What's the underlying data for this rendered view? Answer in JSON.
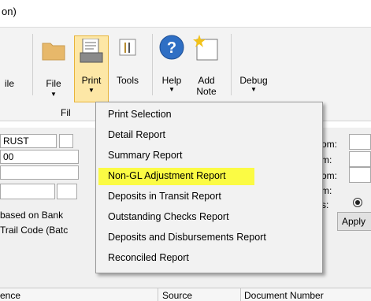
{
  "window": {
    "title_fragment": "on)"
  },
  "ribbon": {
    "file_partial_label": "ile",
    "file_label": "File",
    "print_label": "Print",
    "tools_label": "Tools",
    "help_label": "Help",
    "add_note_label_1": "Add",
    "add_note_label_2": "Note",
    "debug_label": "Debug",
    "group_label_partial": "Fil",
    "dropdown_arrow": "▼"
  },
  "print_menu": {
    "items": [
      "Print Selection",
      "Detail Report",
      "Summary Report",
      "Non-GL Adjustment Report",
      "Deposits in Transit Report",
      "Outstanding Checks Report",
      "Deposits and Disbursements Report",
      "Reconciled Report"
    ],
    "highlighted_index": 3,
    "highlight_color": "#fbfb44"
  },
  "form": {
    "field1_value": "RUST",
    "field2_value": "00",
    "label_right_1": "om:",
    "label_right_2": "m:",
    "label_right_3": "om:",
    "label_right_4": "m:",
    "label_right_5": "s:",
    "based_on_text": "based on Bank",
    "trail_code_text": "Trail Code (Batc",
    "apply_label": "Apply"
  },
  "grid": {
    "columns": [
      "ence",
      "Source",
      "Document Number"
    ]
  },
  "colors": {
    "print_highlight": "#fde7a6",
    "ribbon_bg": "#f3f3f3"
  }
}
